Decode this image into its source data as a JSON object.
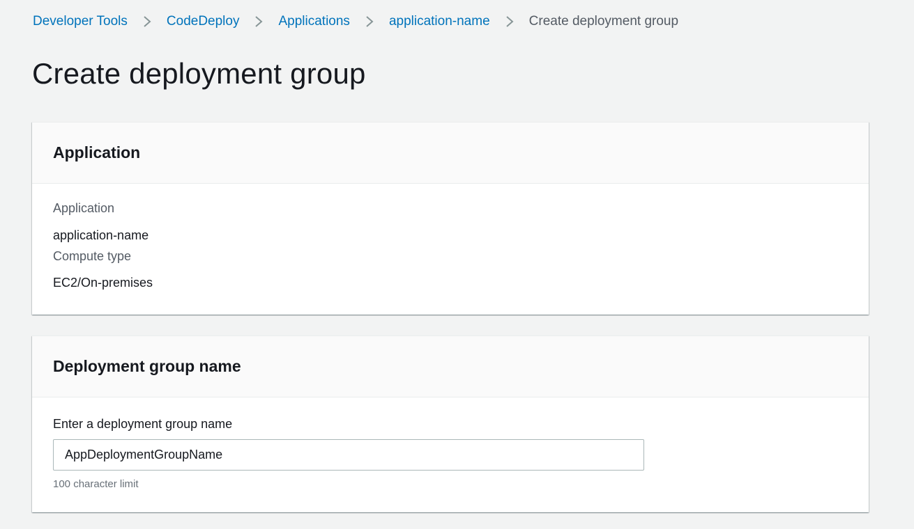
{
  "breadcrumb": {
    "items": [
      {
        "label": "Developer Tools"
      },
      {
        "label": "CodeDeploy"
      },
      {
        "label": "Applications"
      },
      {
        "label": "application-name"
      }
    ],
    "current": "Create deployment group"
  },
  "page": {
    "title": "Create deployment group"
  },
  "application_panel": {
    "title": "Application",
    "application_label": "Application",
    "application_value": "application-name",
    "compute_type_label": "Compute type",
    "compute_type_value": "EC2/On-premises"
  },
  "name_panel": {
    "title": "Deployment group name",
    "field_label": "Enter a deployment group name",
    "field_value": "AppDeploymentGroupName",
    "constraint": "100 character limit"
  },
  "colors": {
    "link": "#0073bb",
    "background": "#f2f3f3",
    "panel": "#ffffff",
    "text": "#16191f",
    "muted": "#545b64"
  }
}
